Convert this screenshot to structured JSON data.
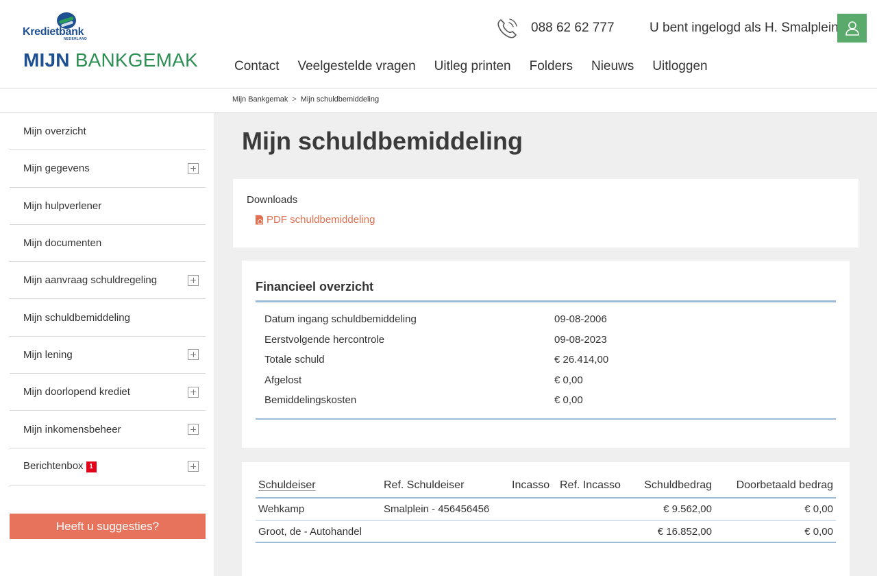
{
  "header": {
    "logo_name": "Kredietbank",
    "logo_sub": "NEDERLAND",
    "brand_part1": "MIJN",
    "brand_part2": "BANKGEMAK",
    "phone": "088 62 62 777",
    "login_text": "U bent ingelogd als H. Smalplein",
    "nav": [
      "Contact",
      "Veelgestelde vragen",
      "Uitleg printen",
      "Folders",
      "Nieuws",
      "Uitloggen"
    ]
  },
  "breadcrumb": {
    "home": "Mijn Bankgemak",
    "separator": ">",
    "current": "Mijn schuldbemiddeling"
  },
  "sidebar": {
    "items": [
      {
        "label": "Mijn overzicht",
        "expandable": false
      },
      {
        "label": "Mijn gegevens",
        "expandable": true
      },
      {
        "label": "Mijn hulpverlener",
        "expandable": false
      },
      {
        "label": "Mijn documenten",
        "expandable": false
      },
      {
        "label": "Mijn aanvraag schuldregeling",
        "expandable": true
      },
      {
        "label": "Mijn schuldbemiddeling",
        "expandable": false
      },
      {
        "label": "Mijn lening",
        "expandable": true
      },
      {
        "label": "Mijn doorlopend krediet",
        "expandable": true
      },
      {
        "label": "Mijn inkomensbeheer",
        "expandable": true
      },
      {
        "label": "Berichtenbox",
        "expandable": true,
        "badge": "1"
      }
    ],
    "suggest_button": "Heeft u suggesties?"
  },
  "main": {
    "title": "Mijn schuldbemiddeling",
    "downloads_label": "Downloads",
    "pdf_link": "PDF schuldbemiddeling",
    "financial": {
      "title": "Financieel overzicht",
      "rows": [
        {
          "label": "Datum ingang schuldbemiddeling",
          "value": "09-08-2006"
        },
        {
          "label": "Eerstvolgende hercontrole",
          "value": "09-08-2023"
        },
        {
          "label": "Totale schuld",
          "value": "€ 26.414,00"
        },
        {
          "label": "Afgelost",
          "value": "€ 0,00"
        },
        {
          "label": "Bemiddelingskosten",
          "value": "€ 0,00"
        }
      ]
    },
    "table": {
      "headers": [
        "Schuldeiser",
        "Ref. Schuldeiser",
        "Incasso",
        "Ref. Incasso",
        "Schuldbedrag",
        "Doorbetaald bedrag"
      ],
      "rows": [
        [
          "Wehkamp",
          "Smalplein - 456456456",
          "",
          "",
          "€ 9.562,00",
          "€ 0,00"
        ],
        [
          "Groot, de - Autohandel",
          "",
          "",
          "",
          "€ 16.852,00",
          "€ 0,00"
        ]
      ]
    }
  },
  "colors": {
    "brand_blue": "#1d4f91",
    "brand_green": "#2e8f55",
    "user_button": "#5aaa6b",
    "accent_orange": "#e8735c",
    "link_orange": "#e0704f",
    "badge_red": "#e2001a",
    "table_rule": "#9bbcd8"
  }
}
